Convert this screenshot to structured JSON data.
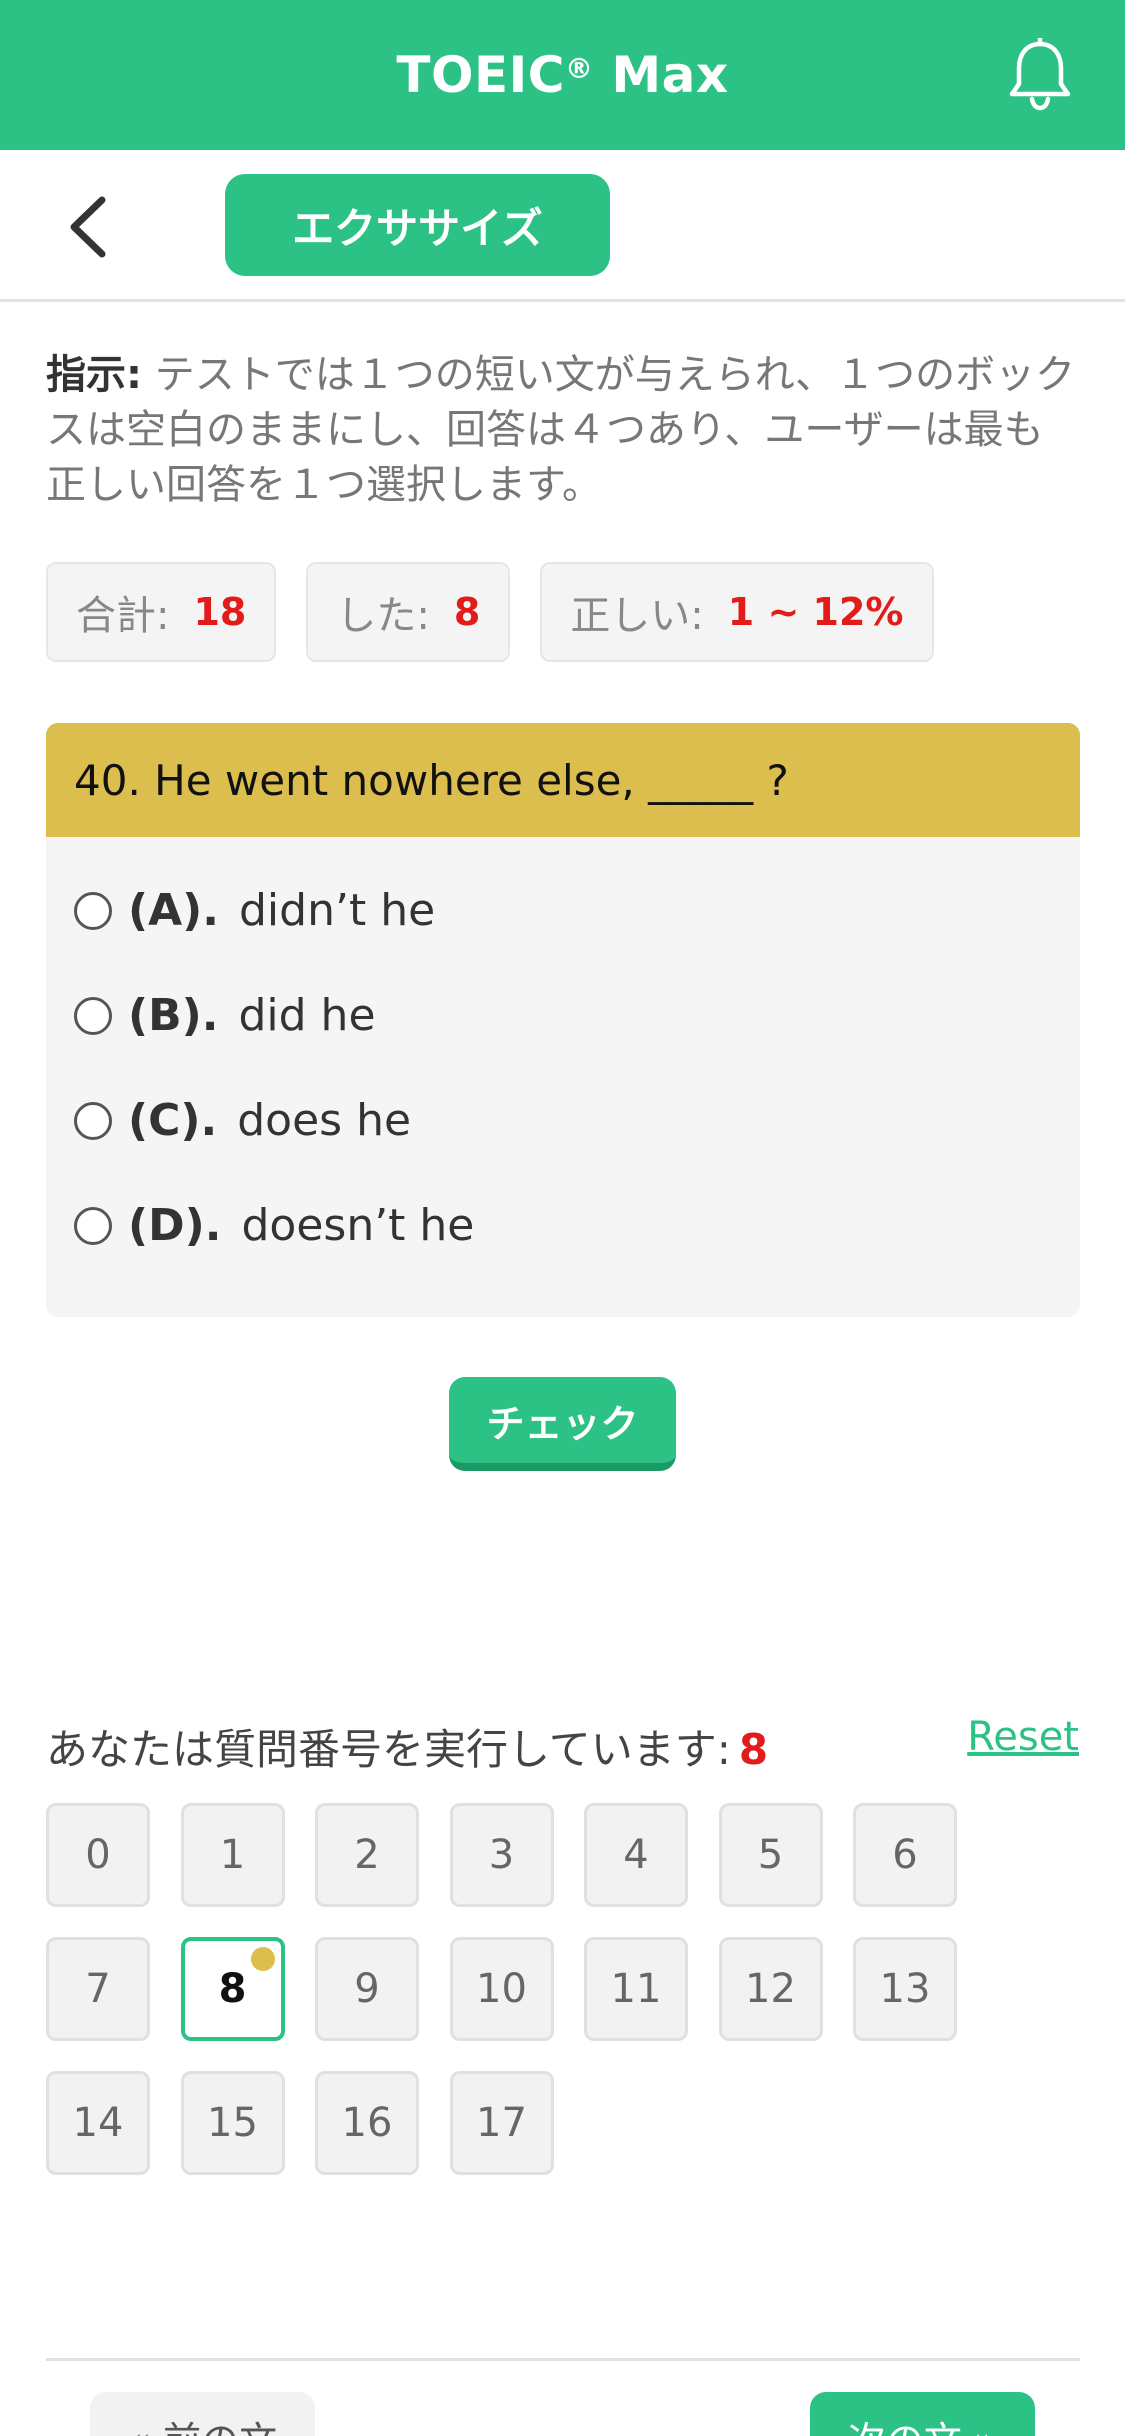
{
  "header": {
    "title": "TOEIC",
    "title_reg": "®",
    "title_suffix": " Max",
    "bell_icon": "bell-icon"
  },
  "subheader": {
    "back_icon": "chevron-left-icon",
    "tab_label": "エクササイズ"
  },
  "instructions": {
    "label": "指示:",
    "text": " テストでは１つの短い文が与えられ、１つのボックスは空白のままにし、回答は４つあり、ユーザーは最も正しい回答を１つ選択します。"
  },
  "stats": [
    {
      "label": "合計:",
      "value": "18"
    },
    {
      "label": "した:",
      "value": "8"
    },
    {
      "label": "正しい:",
      "value": "1 ~ 12%"
    }
  ],
  "question": {
    "text": "40. He went nowhere else, _____ ?",
    "options": [
      {
        "letter": "(A).",
        "text": "didn’t he"
      },
      {
        "letter": "(B).",
        "text": "did he"
      },
      {
        "letter": "(C).",
        "text": "does he"
      },
      {
        "letter": "(D).",
        "text": "doesn’t he"
      }
    ]
  },
  "check_label": "チェック",
  "progress": {
    "label": "あなたは質問番号を実行しています:",
    "current": "8",
    "reset_label": "Reset",
    "numbers": [
      "0",
      "1",
      "2",
      "3",
      "4",
      "5",
      "6",
      "7",
      "8",
      "9",
      "10",
      "11",
      "12",
      "13",
      "14",
      "15",
      "16",
      "17"
    ],
    "active_index": 8
  },
  "nav": {
    "prev_label": "« 前の文",
    "next_label": "次の文 »"
  },
  "colors": {
    "brand": "#2cc286",
    "question_header": "#dbbe4e",
    "accent_red": "#e21b1b"
  }
}
